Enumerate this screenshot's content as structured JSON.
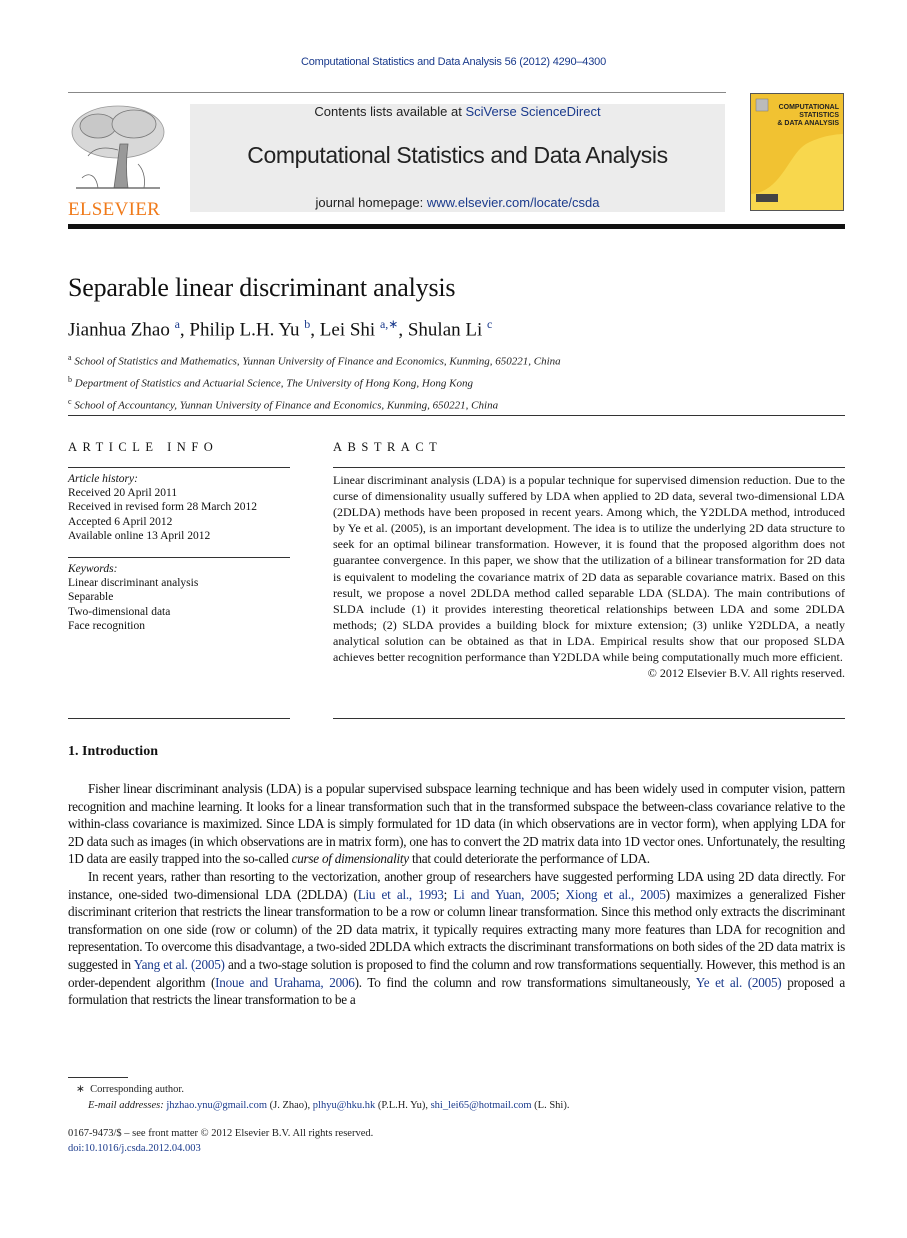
{
  "running_head": "Computational Statistics and Data Analysis 56 (2012) 4290–4300",
  "header": {
    "publisher_logo_text": "ELSEVIER",
    "contents_prefix": "Contents lists available at ",
    "contents_link": "SciVerse ScienceDirect",
    "journal_title": "Computational Statistics and Data Analysis",
    "homepage_prefix": "journal homepage: ",
    "homepage_link": "www.elsevier.com/locate/csda",
    "cover_title_lines": [
      "COMPUTATIONAL",
      "STATISTICS",
      "& DATA ANALYSIS"
    ],
    "colors": {
      "link": "#1a3a8c",
      "publisher": "#f07a1a",
      "cover": "#f1c232",
      "banner": "#ececec"
    }
  },
  "article": {
    "title": "Separable linear discriminant analysis",
    "authors": [
      {
        "name": "Jianhua Zhao",
        "sup": "a"
      },
      {
        "name": "Philip L.H. Yu",
        "sup": "b"
      },
      {
        "name": "Lei Shi",
        "sup": "a,∗"
      },
      {
        "name": "Shulan Li",
        "sup": "c"
      }
    ],
    "affiliations": [
      {
        "mark": "a",
        "text": "School of Statistics and Mathematics, Yunnan University of Finance and Economics, Kunming, 650221, China"
      },
      {
        "mark": "b",
        "text": "Department of Statistics and Actuarial Science, The University of Hong Kong, Hong Kong"
      },
      {
        "mark": "c",
        "text": "School of Accountancy, Yunnan University of Finance and Economics, Kunming, 650221, China"
      }
    ]
  },
  "article_info": {
    "heading": "ARTICLE INFO",
    "history_label": "Article history:",
    "history": [
      "Received 20 April 2011",
      "Received in revised form 28 March 2012",
      "Accepted 6 April 2012",
      "Available online 13 April 2012"
    ],
    "keywords_label": "Keywords:",
    "keywords": [
      "Linear discriminant analysis",
      "Separable",
      "Two-dimensional data",
      "Face recognition"
    ]
  },
  "abstract": {
    "heading": "ABSTRACT",
    "text": "Linear discriminant analysis (LDA) is a popular technique for supervised dimension reduction. Due to the curse of dimensionality usually suffered by LDA when applied to 2D data, several two-dimensional LDA (2DLDA) methods have been proposed in recent years. Among which, the Y2DLDA method, introduced by Ye et al. (2005), is an important development. The idea is to utilize the underlying 2D data structure to seek for an optimal bilinear transformation. However, it is found that the proposed algorithm does not guarantee convergence. In this paper, we show that the utilization of a bilinear transformation for 2D data is equivalent to modeling the covariance matrix of 2D data as separable covariance matrix. Based on this result, we propose a novel 2DLDA method called separable LDA (SLDA). The main contributions of SLDA include (1) it provides interesting theoretical relationships between LDA and some 2DLDA methods; (2) SLDA provides a building block for mixture extension; (3) unlike Y2DLDA, a neatly analytical solution can be obtained as that in LDA. Empirical results show that our proposed SLDA achieves better recognition performance than Y2DLDA while being computationally much more efficient.",
    "copyright": "© 2012 Elsevier B.V. All rights reserved."
  },
  "introduction": {
    "heading": "1.  Introduction",
    "p1_a": "Fisher linear discriminant analysis (LDA) is a popular supervised subspace learning technique and has been widely used in computer vision, pattern recognition and machine learning. It looks for a linear transformation such that in the transformed subspace the between-class covariance relative to the within-class covariance is maximized. Since LDA is simply formulated for 1D data (in which observations are in vector form), when applying LDA for 2D data such as images (in which observations are in matrix form), one has to convert the 2D matrix data into 1D vector ones. Unfortunately, the resulting 1D data are easily trapped into the so-called ",
    "p1_em": "curse of dimensionality",
    "p1_b": " that could deteriorate the performance of LDA.",
    "p2_a": "In recent years, rather than resorting to the vectorization, another group of researchers have suggested performing LDA using 2D data directly. For instance, one-sided two-dimensional LDA (2DLDA) (",
    "cite_liu": "Liu et al., 1993",
    "sep1": "; ",
    "cite_li": "Li and Yuan, 2005",
    "sep2": "; ",
    "cite_xiong": "Xiong et al., 2005",
    "p2_b": ") maximizes a generalized Fisher discriminant criterion that restricts the linear transformation to be a row or column linear transformation. Since this method only extracts the discriminant transformation on one side (row or column) of the 2D data matrix, it typically requires extracting many more features than LDA for recognition and representation. To overcome this disadvantage, a two-sided 2DLDA which extracts the discriminant transformations on both sides of the 2D data matrix is suggested in ",
    "cite_yang": "Yang et al. (2005)",
    "p2_c": " and a two-stage solution is proposed to find the column and row transformations sequentially. However, this method is an order-dependent algorithm (",
    "cite_inoue": "Inoue and Urahama, 2006",
    "p2_d": "). To find the column and row transformations simultaneously, ",
    "cite_ye": "Ye et al. (2005)",
    "p2_e": " proposed a formulation that restricts the linear transformation to be a"
  },
  "footnotes": {
    "star": "∗",
    "corresponding": "Corresponding author.",
    "email_label": "E-mail addresses:",
    "emails": [
      {
        "address": "jhzhao.ynu@gmail.com",
        "who": " (J. Zhao), "
      },
      {
        "address": "plhyu@hku.hk",
        "who": " (P.L.H. Yu), "
      },
      {
        "address": "shi_lei65@hotmail.com",
        "who": " (L. Shi)."
      }
    ],
    "front_matter": "0167-9473/$ – see front matter © 2012 Elsevier B.V. All rights reserved.",
    "doi": "doi:10.1016/j.csda.2012.04.003"
  }
}
